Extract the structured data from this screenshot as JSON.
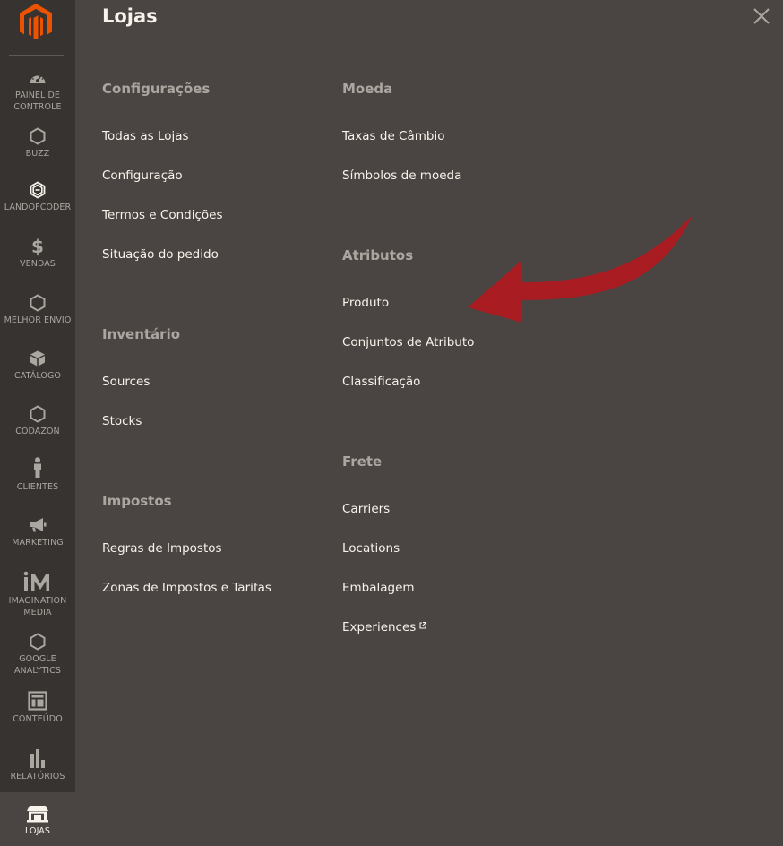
{
  "sidebar": {
    "logo_icon": "magento-logo-icon",
    "items": [
      {
        "label": "PAINEL DE CONTROLE",
        "icon": "dashboard-icon"
      },
      {
        "label": "BUZZ",
        "icon": "hexagon-icon"
      },
      {
        "label": "LANDOFCODER",
        "icon": "landofcoder-icon"
      },
      {
        "label": "VENDAS",
        "icon": "dollar-icon"
      },
      {
        "label": "MELHOR ENVIO",
        "icon": "hexagon-icon"
      },
      {
        "label": "CATÁLOGO",
        "icon": "box-icon"
      },
      {
        "label": "CODAZON",
        "icon": "hexagon-icon"
      },
      {
        "label": "CLIENTES",
        "icon": "person-icon"
      },
      {
        "label": "MARKETING",
        "icon": "megaphone-icon"
      },
      {
        "label": "IMAGINATION MEDIA",
        "icon": "imagination-media-icon"
      },
      {
        "label": "GOOGLE ANALYTICS",
        "icon": "hexagon-icon"
      },
      {
        "label": "CONTEÚDO",
        "icon": "layout-icon"
      },
      {
        "label": "RELATÓRIOS",
        "icon": "bar-chart-icon"
      },
      {
        "label": "LOJAS",
        "icon": "store-icon"
      }
    ]
  },
  "panel": {
    "title": "Lojas",
    "close_icon": "close-icon",
    "columns": [
      {
        "sections": [
          {
            "title": "Configurações",
            "links": [
              "Todas as Lojas",
              "Configuração",
              "Termos e Condições",
              "Situação do pedido"
            ]
          },
          {
            "title": "Inventário",
            "links": [
              "Sources",
              "Stocks"
            ]
          },
          {
            "title": "Impostos",
            "links": [
              "Regras de Impostos",
              "Zonas de Impostos e Tarifas"
            ]
          }
        ]
      },
      {
        "sections": [
          {
            "title": "Moeda",
            "links": [
              "Taxas de Câmbio",
              "Símbolos de moeda"
            ]
          },
          {
            "title": "Atributos",
            "links": [
              "Produto",
              "Conjuntos de Atributo",
              "Classificação"
            ]
          },
          {
            "title": "Frete",
            "links": [
              "Carriers",
              "Locations",
              "Embalagem",
              "Experiences"
            ]
          }
        ]
      }
    ]
  },
  "colors": {
    "sidebar_bg": "#373330",
    "panel_bg": "#4a4542",
    "logo_orange": "#eb5202",
    "arrow_red": "#a81c22",
    "section_title": "#aaa6a0",
    "link_text": "#f7f3eb"
  },
  "annotation": {
    "icon": "red-arrow-icon"
  }
}
